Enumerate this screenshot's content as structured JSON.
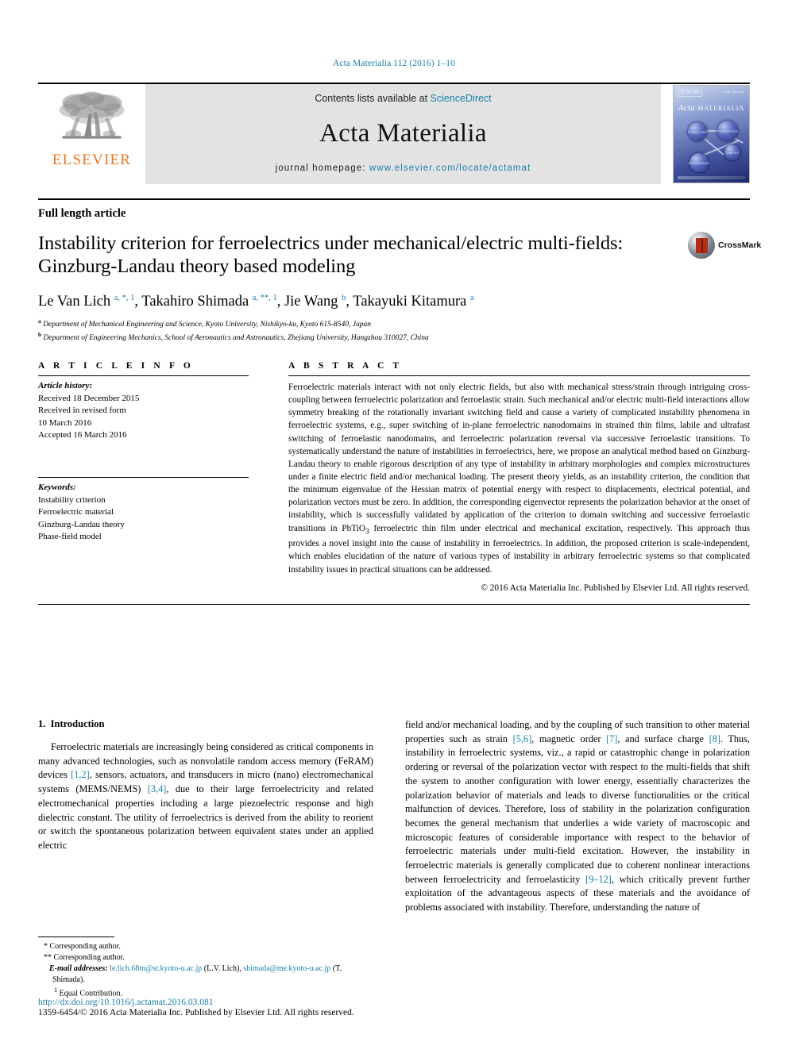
{
  "running_head": "Acta Materialia 112 (2016) 1–10",
  "masthead": {
    "publisher_name": "ELSEVIER",
    "contents_prefix": "Contents lists available at ",
    "contents_link": "ScienceDirect",
    "journal_title": "Acta Materialia",
    "homepage_prefix": "journal homepage: ",
    "homepage_url": "www.elsevier.com/locate/actamat",
    "cover": {
      "brand": "ELSEVIER",
      "corner_text": "ISSN 1359-6454",
      "title_italic": "Acta",
      "title_caps": "MATERIALIA",
      "nodes": [
        "STRUCTURE",
        "PROPERTIES",
        "THEORY",
        "PROCESSING"
      ]
    }
  },
  "article": {
    "type": "Full length article",
    "title": "Instability criterion for ferroelectrics under mechanical/electric multi-fields: Ginzburg-Landau theory based modeling",
    "authors_html": "Le Van Lich <sup>a, *, 1</sup>, Takahiro Shimada <sup>a, **, 1</sup>, Jie Wang <sup>b</sup>, Takayuki Kitamura <sup>a</sup>",
    "affiliations": [
      {
        "marker": "a",
        "text": "Department of Mechanical Engineering and Science, Kyoto University, Nishikyo-ku, Kyoto 615-8540, Japan"
      },
      {
        "marker": "b",
        "text": "Department of Engineering Mechanics, School of Aeronautics and Astronautics, Zhejiang University, Hangzhou 310027, China"
      }
    ],
    "crossmark_label": "CrossMark"
  },
  "info": {
    "heading": "A R T I C L E  I N F O",
    "history_label": "Article history:",
    "history": [
      "Received 18 December 2015",
      "Received in revised form",
      "10 March 2016",
      "Accepted 16 March 2016"
    ],
    "keywords_label": "Keywords:",
    "keywords": [
      "Instability criterion",
      "Ferroelectric material",
      "Ginzburg-Landau theory",
      "Phase-field model"
    ]
  },
  "abstract": {
    "heading": "A B S T R A C T",
    "text": "Ferroelectric materials interact with not only electric fields, but also with mechanical stress/strain through intriguing cross-coupling between ferroelectric polarization and ferroelastic strain. Such mechanical and/or electric multi-field interactions allow symmetry breaking of the rotationally invariant switching field and cause a variety of complicated instability phenomena in ferroelectric systems, e.g., super switching of in-plane ferroelectric nanodomains in strained thin films, labile and ultrafast switching of ferroelastic nanodomains, and ferroelectric polarization reversal via successive ferroelastic transitions. To systematically understand the nature of instabilities in ferroelectrics, here, we propose an analytical method based on Ginzburg-Landau theory to enable rigorous description of any type of instability in arbitrary morphologies and complex microstructures under a finite electric field and/or mechanical loading. The present theory yields, as an instability criterion, the condition that the minimum eigenvalue of the Hessian matrix of potential energy with respect to displacements, electrical potential, and polarization vectors must be zero. In addition, the corresponding eigenvector represents the polarization behavior at the onset of instability, which is successfully validated by application of the criterion to domain switching and successive ferroelastic transitions in PbTiO3 ferroelectric thin film under electrical and mechanical excitation, respectively. This approach thus provides a novel insight into the cause of instability in ferroelectrics. In addition, the proposed criterion is scale-independent, which enables elucidation of the nature of various types of instability in arbitrary ferroelectric systems so that complicated instability issues in practical situations can be addressed.",
    "copyright": "© 2016 Acta Materialia Inc. Published by Elsevier Ltd. All rights reserved."
  },
  "body": {
    "section_number": "1.",
    "section_title": "Introduction",
    "left_paragraph_parts": [
      "Ferroelectric materials are increasingly being considered as critical components in many advanced technologies, such as nonvolatile random access memory (FeRAM) devices ",
      "[1,2]",
      ", sensors, actuators, and transducers in micro (nano) electromechanical systems (MEMS/NEMS) ",
      "[3,4]",
      ", due to their large ferroelectricity and related electromechanical properties including a large piezoelectric response and high dielectric constant. The utility of ferroelectrics is derived from the ability to reorient or switch the spontaneous polarization between equivalent states under an applied electric"
    ],
    "right_paragraph_parts": [
      "field and/or mechanical loading, and by the coupling of such transition to other material properties such as strain ",
      "[5,6]",
      ", magnetic order ",
      "[7]",
      ", and surface charge ",
      "[8]",
      ". Thus, instability in ferroelectric systems, viz., a rapid or catastrophic change in polarization ordering or reversal of the polarization vector with respect to the multi-fields that shift the system to another configuration with lower energy, essentially characterizes the polarization behavior of materials and leads to diverse functionalities or the critical malfunction of devices. Therefore, loss of stability in the polarization configuration becomes the general mechanism that underlies a wide variety of macroscopic and microscopic features of considerable importance with respect to the behavior of ferroelectric materials under multi-field excitation. However, the instability in ferroelectric materials is generally complicated due to coherent nonlinear interactions between ferroelectricity and ferroelasticity ",
      "[9–12]",
      ", which critically prevent further exploitation of the advantageous aspects of these materials and the avoidance of problems associated with instability. Therefore, understanding the nature of"
    ]
  },
  "footnotes": {
    "corr1": "* Corresponding author.",
    "corr2": "** Corresponding author.",
    "email_label": "E-mail addresses:",
    "email1": "le.lich.68m@st.kyoto-u.ac.jp",
    "email1_owner": " (L.V. Lich), ",
    "email2": "shimada@me.kyoto-u.ac.jp",
    "email2_owner": " (T. Shimada).",
    "equal_marker": "1",
    "equal": "Equal Contribution."
  },
  "doi_block": {
    "doi": "http://dx.doi.org/10.1016/j.actamat.2016.03.081",
    "issn_line": "1359-6454/© 2016 Acta Materialia Inc. Published by Elsevier Ltd. All rights reserved."
  },
  "colors": {
    "link": "#1a7fa8",
    "elsevier_orange": "#E87722",
    "masthead_bg": "#e3e3e3"
  }
}
